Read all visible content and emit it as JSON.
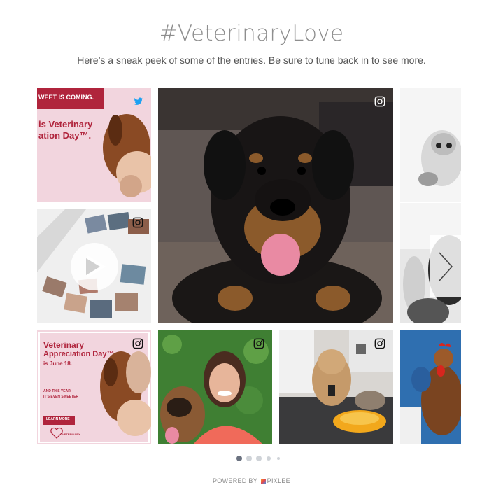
{
  "header": {
    "title": "#VeterinaryLove",
    "subtitle": "Here’s a sneak peek of some of the entries. Be sure to tune back in to see more."
  },
  "tiles": {
    "tile1": {
      "source": "twitter-icon",
      "line1": "WEET IS COMING.",
      "line2": "is Veterinary",
      "line3": "ation Day™."
    },
    "tile2": {
      "source": "instagram-icon"
    },
    "tile3": {
      "source": "instagram-icon"
    },
    "tile4": {
      "source": "instagram-icon"
    },
    "tile5": {
      "source": "instagram-icon",
      "line1": "Veterinary",
      "line2": "Appreciation Day™",
      "line3": "is June 18.",
      "line4": "AND THIS YEAR,",
      "line5": "IT'S EVEN SWEETER",
      "button": "LEARN MORE",
      "logo": "VETERINARY"
    },
    "tile6": {
      "source": "instagram-icon"
    },
    "tile7": {
      "source": "instagram-icon"
    },
    "tile8": {
      "source": "none"
    }
  },
  "carousel": {
    "next_icon": "chevron-right-icon",
    "pages": 5,
    "active_page": 1
  },
  "footer": {
    "powered_by": "POWERED BY",
    "brand": "PIXLEE"
  },
  "colors": {
    "pink": "#f2d6de",
    "accent_red": "#b0243c",
    "title_gray": "#8e8e8e",
    "twitter_blue": "#1da1f2"
  }
}
